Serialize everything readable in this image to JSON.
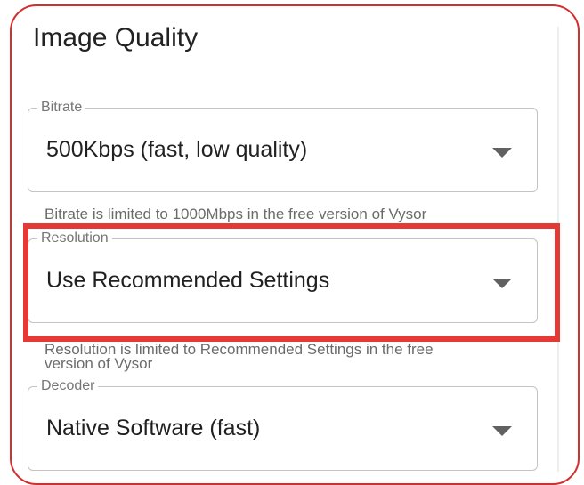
{
  "section": {
    "title": "Image Quality"
  },
  "bitrate": {
    "label": "Bitrate",
    "value": "500Kbps (fast, low quality)",
    "helper": "Bitrate is limited to 1000Mbps in the free version of Vysor"
  },
  "resolution": {
    "label": "Resolution",
    "value": "Use Recommended Settings",
    "helper_line1": "Resolution is limited to Recommended Settings in the free",
    "helper_line2": "version of Vysor"
  },
  "decoder": {
    "label": "Decoder",
    "value": "Native Software (fast)"
  },
  "colors": {
    "highlight": "#e53935",
    "panel_border": "#d32f2f"
  }
}
